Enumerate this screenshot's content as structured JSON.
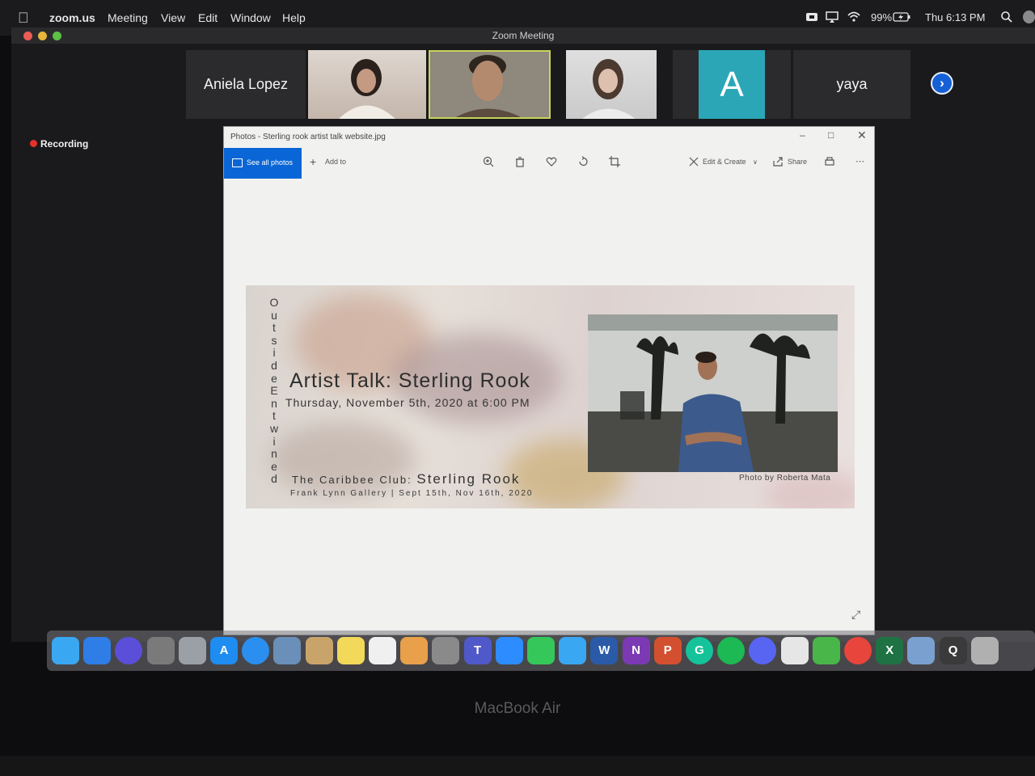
{
  "menubar": {
    "app_name": "zoom.us",
    "menus": [
      "Meeting",
      "View",
      "Edit",
      "Window",
      "Help"
    ],
    "battery": "99%",
    "clock": "Thu 6:13 PM"
  },
  "zoom": {
    "window_title": "Zoom Meeting",
    "participants": [
      {
        "name": "Aniela Lopez",
        "type": "name"
      },
      {
        "name": "",
        "type": "video"
      },
      {
        "name": "",
        "type": "video",
        "active": true
      },
      {
        "name": "",
        "type": "video"
      },
      {
        "name": "A",
        "type": "avatar"
      },
      {
        "name": "yaya",
        "type": "name"
      }
    ],
    "recording_label": "Recording"
  },
  "photos": {
    "title": "Photos - Sterling rook artist talk website.jpg",
    "see_all": "See all photos",
    "add_to": "Add to",
    "edit_create": "Edit & Create",
    "share": "Share"
  },
  "poster": {
    "vertical_text": "Outside Entwined",
    "title": "Artist Talk: Sterling Rook",
    "date": "Thursday, November 5th, 2020 at 6:00 PM",
    "club_prefix": "The Caribbee Club:",
    "club_name": "Sterling Rook",
    "gallery": "Frank Lynn Gallery | Sept 15th, Nov 16th, 2020",
    "photo_credit": "Photo by Roberta Mata"
  },
  "laptop_brand": "MacBook Air",
  "colors": {
    "zoom_blue": "#1560d6",
    "photos_blue": "#0a66d6",
    "recording_red": "#e7322b",
    "avatar_teal": "#2aa6b7"
  },
  "dock_apps": [
    "Messages",
    "Finder",
    "Siri",
    "System Preferences",
    "Launchpad",
    "App Store",
    "Safari",
    "Preview",
    "Contacts",
    "Notes",
    "Reminders",
    "Photos",
    "Calculator",
    "Microsoft Teams",
    "Zoom",
    "FaceTime",
    "Messages",
    "Microsoft Word",
    "Microsoft OneNote",
    "Microsoft PowerPoint",
    "Grammarly",
    "Spotify",
    "Discord",
    "Roblox",
    "The Sims",
    "Google Chrome",
    "Microsoft Excel",
    "Preview",
    "QuickTime",
    "Trash"
  ]
}
